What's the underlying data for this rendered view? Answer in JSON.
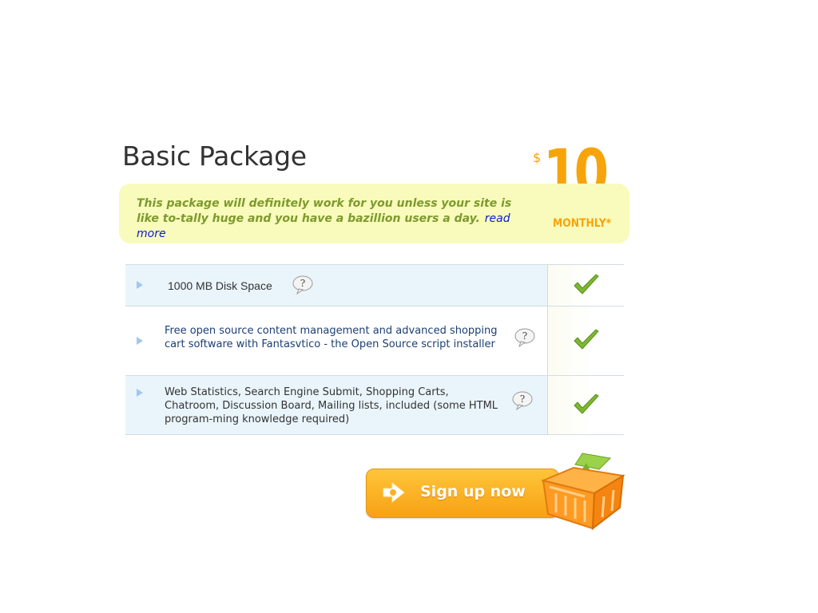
{
  "package": {
    "title": "Basic Package",
    "description": "This package will definitely work for you unless your site is like to-tally huge and you have a bazillion users a day.",
    "read_more": "read more"
  },
  "price": {
    "currency": "$",
    "amount": "10",
    "period": "MONTHLY*"
  },
  "features": [
    {
      "text": "1000 MB Disk Space",
      "included": true
    },
    {
      "text": "Free open source content management and advanced shopping cart software with Fantasvtico - the Open Source script installer",
      "included": true
    },
    {
      "text": "Web Statistics, Search Engine Submit, Shopping Carts, Chatroom, Discussion Board, Mailing lists, included (some HTML program-ming knowledge required)",
      "included": true
    }
  ],
  "signup": {
    "label": "Sign up now"
  },
  "icons": {
    "bullet": "triangle-bullet-icon",
    "help": "question-bubble-icon",
    "check": "green-checkmark-icon",
    "signup_arrow": "arrow-icon",
    "basket": "shopping-basket-icon"
  },
  "colors": {
    "accent": "#f7a40b",
    "desc_bg": "#f8fbbb",
    "desc_text": "#7d9a2c",
    "link": "#0a1ad8",
    "row_shade": "#eaf5fb",
    "check": "#7bb92f"
  }
}
